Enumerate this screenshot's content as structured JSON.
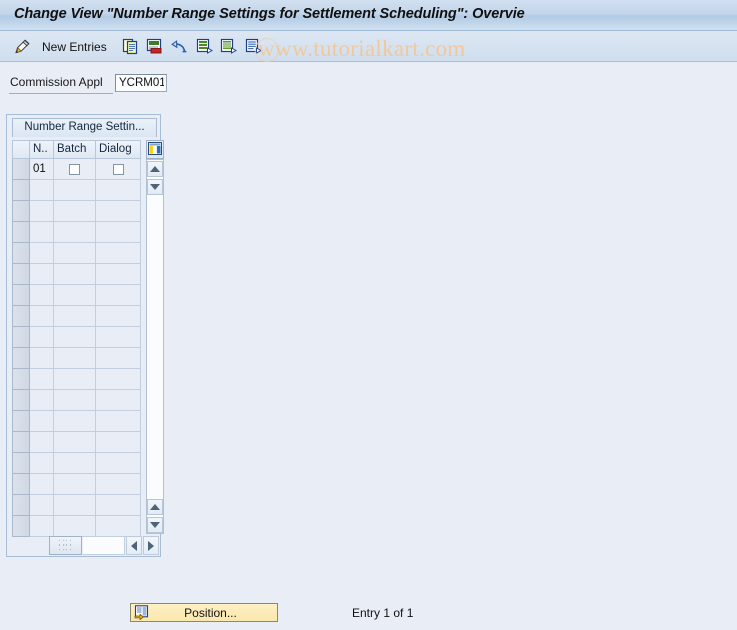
{
  "window": {
    "title": "Change View \"Number Range Settings for Settlement Scheduling\": Overvie"
  },
  "toolbar": {
    "change_doc_icon": "pencil-document-icon",
    "new_entries_label": "New Entries",
    "icons": [
      {
        "name": "copy-icon",
        "title": "Copy As..."
      },
      {
        "name": "delete-icon",
        "title": "Delete"
      },
      {
        "name": "undo-icon",
        "title": "Undo Change"
      },
      {
        "name": "select-all-icon",
        "title": "Select All"
      },
      {
        "name": "deselect-all-icon",
        "title": "Deselect All"
      },
      {
        "name": "select-block-icon",
        "title": "Select Block"
      }
    ]
  },
  "watermark": {
    "text": "www.tutorialkart.com",
    "color": "#f2c89a"
  },
  "field": {
    "label": "Commission Appl",
    "value": "YCRM01"
  },
  "table": {
    "title": "Number Range Settin...",
    "config_icon": "grid-config-icon",
    "columns": [
      {
        "key": "sel",
        "label": ""
      },
      {
        "key": "num",
        "label": "N.."
      },
      {
        "key": "batch",
        "label": "Batch"
      },
      {
        "key": "dlg",
        "label": "Dialog"
      }
    ],
    "rows": [
      {
        "num": "01",
        "batch": false,
        "dialog": false
      }
    ],
    "empty_row_count": 17,
    "scroll": {
      "up_icon": "scroll-up-icon",
      "down_icon": "scroll-down-icon",
      "left_icon": "scroll-left-icon",
      "right_icon": "scroll-right-icon",
      "grip_icon": "horizontal-scroll-grip-icon"
    }
  },
  "footer": {
    "position_label": "Position...",
    "position_icon": "position-icon",
    "entry_status": "Entry 1 of 1"
  },
  "theme": {
    "background": "#e9eef6",
    "title_bar": "#c2d5ea",
    "border": "#a7bdd6",
    "button_yellow": "#fae7ad"
  }
}
